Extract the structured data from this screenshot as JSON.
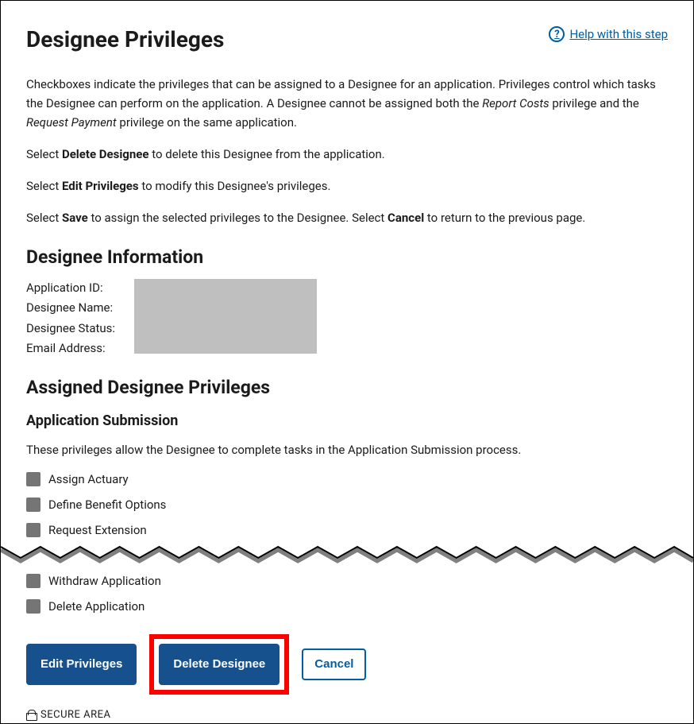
{
  "header": {
    "title": "Designee Privileges",
    "help_label": "Help with this step"
  },
  "intro": {
    "p1_prefix": "Checkboxes indicate the privileges that can be assigned to a Designee for an application. Privileges control which tasks the Designee can perform on the application. A Designee cannot be assigned both the ",
    "p1_em1": "Report Costs",
    "p1_mid": " privilege and the ",
    "p1_em2": "Request Payment",
    "p1_suffix": " privilege on the same application.",
    "p2_prefix": "Select ",
    "p2_b": "Delete Designee",
    "p2_suffix": " to delete this Designee from the application.",
    "p3_prefix": "Select ",
    "p3_b": "Edit Privileges",
    "p3_suffix": " to modify this Designee's privileges.",
    "p4_prefix": "Select ",
    "p4_b1": "Save",
    "p4_mid": " to assign the selected privileges to the Designee. Select ",
    "p4_b2": "Cancel",
    "p4_suffix": " to return to the previous page."
  },
  "info": {
    "heading": "Designee Information",
    "labels": {
      "app_id": "Application ID:",
      "name": "Designee Name:",
      "status": "Designee Status:",
      "email": "Email Address:"
    }
  },
  "privileges": {
    "heading": "Assigned Designee Privileges",
    "section1_title": "Application Submission",
    "section1_desc": "These privileges allow the Designee to complete tasks in the Application Submission process.",
    "items": {
      "assign_actuary": "Assign Actuary",
      "define_benefit": "Define Benefit Options",
      "request_extension": "Request Extension",
      "withdraw": "Withdraw Application",
      "delete_app": "Delete Application"
    }
  },
  "buttons": {
    "edit": "Edit Privileges",
    "delete": "Delete Designee",
    "cancel": "Cancel"
  },
  "footer": {
    "secure": "SECURE AREA"
  }
}
